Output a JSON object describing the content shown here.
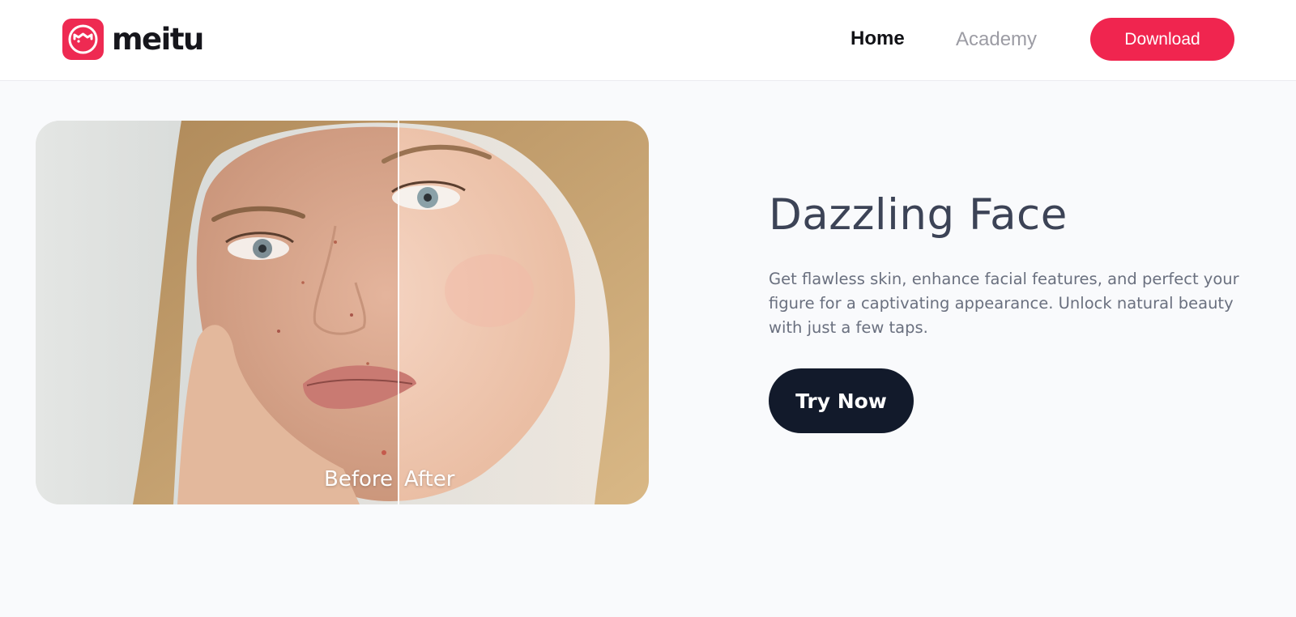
{
  "header": {
    "logo_text": "meitu",
    "nav": {
      "home_label": "Home",
      "academy_label": "Academy"
    },
    "download_label": "Download"
  },
  "hero": {
    "image": {
      "before_label": "Before",
      "after_label": "After"
    },
    "title": "Dazzling Face",
    "description": "Get flawless skin, enhance facial features, and perfect your figure for a captivating appearance. Unlock natural beauty with just a few taps.",
    "cta_label": "Try Now"
  },
  "colors": {
    "brand": "#ee2a52",
    "download_button": "#f0254f",
    "cta_button": "#121a2b",
    "title": "#3c4356",
    "body_text": "#6a707f",
    "nav_active": "#111216",
    "nav_inactive": "#9c9ca4"
  },
  "icons": {
    "logo": "meitu-logo-icon"
  }
}
